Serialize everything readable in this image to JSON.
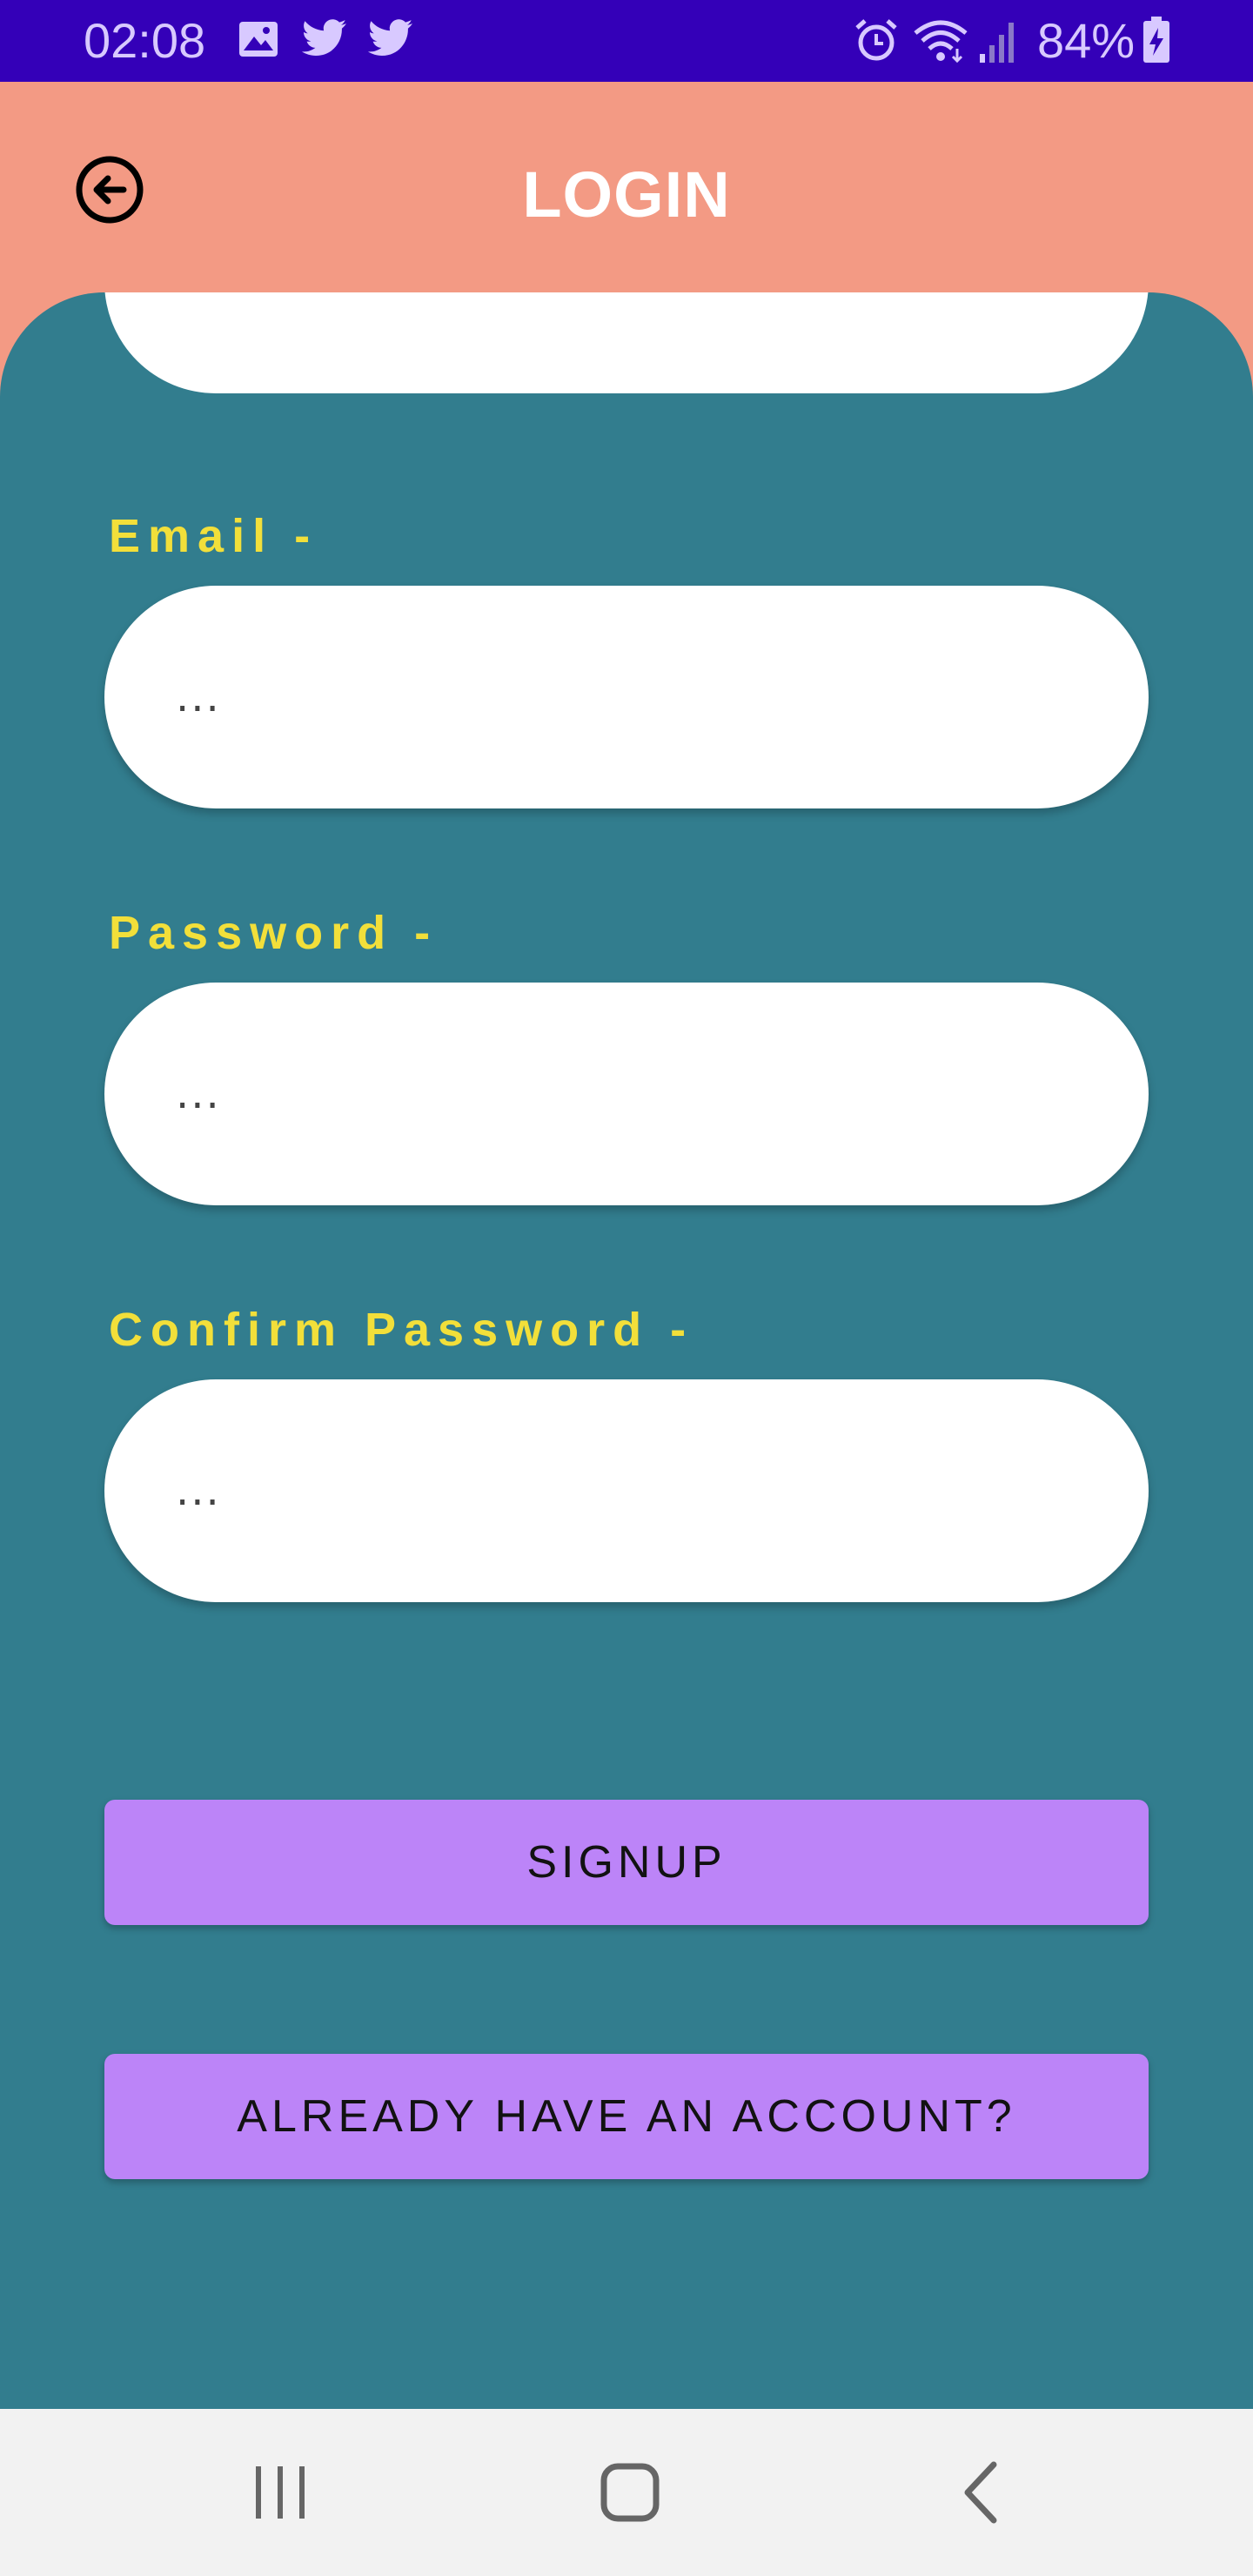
{
  "status_bar": {
    "time": "02:08",
    "battery": "84%",
    "icons": [
      "gallery-icon",
      "twitter-icon",
      "twitter-icon",
      "alarm-icon",
      "wifi-icon",
      "signal-icon",
      "battery-charging-icon"
    ]
  },
  "header": {
    "title": "LOGIN",
    "back_icon": "back-arrow-circle-icon"
  },
  "form": {
    "email": {
      "label": "Email -",
      "value": "..."
    },
    "password": {
      "label": "Password -",
      "value": "..."
    },
    "confirm_password": {
      "label": "Confirm Password -",
      "value": "..."
    }
  },
  "buttons": {
    "signup": "SIGNUP",
    "already_have_account": "ALREADY HAVE AN ACCOUNT?"
  },
  "nav_bar": {
    "icons": [
      "recent-apps-icon",
      "home-icon",
      "back-icon"
    ]
  },
  "colors": {
    "status_bar": "#3400b8",
    "header": "#f39a84",
    "panel": "#327d8e",
    "label": "#f2df3a",
    "button": "#bc84f8"
  }
}
